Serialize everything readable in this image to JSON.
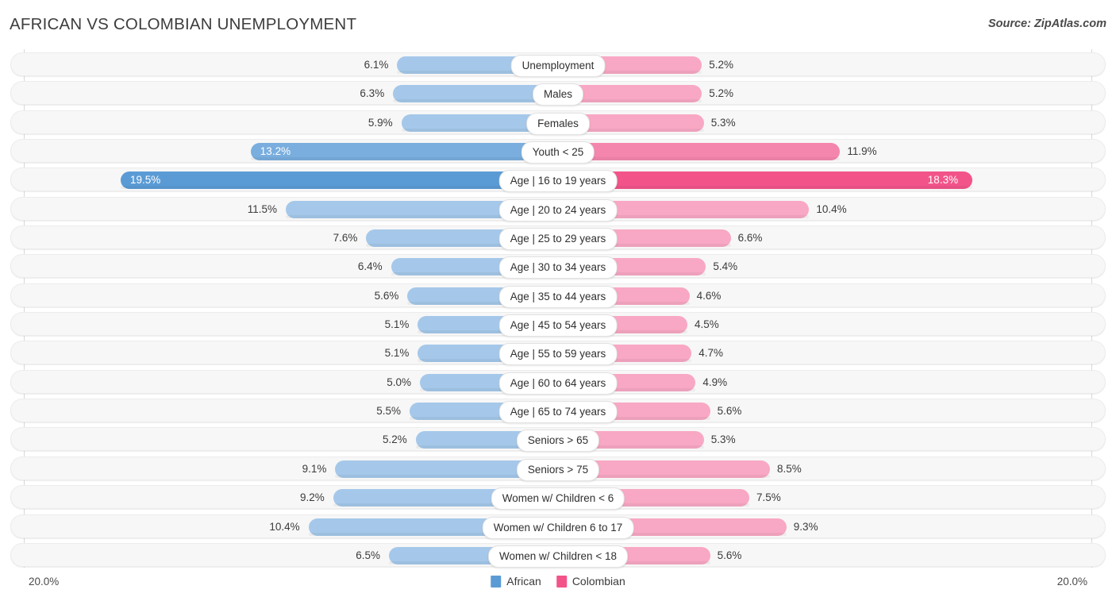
{
  "header": {
    "title": "AFRICAN VS COLOMBIAN UNEMPLOYMENT",
    "source": "Source: ZipAtlas.com"
  },
  "legend": {
    "items": [
      {
        "label": "African",
        "color": "#5b9bd5"
      },
      {
        "label": "Colombian",
        "color": "#f2548a"
      }
    ]
  },
  "axis": {
    "min_label": "20.0%",
    "max_label": "20.0%"
  },
  "chart_data": {
    "type": "bar",
    "title": "AFRICAN VS COLOMBIAN UNEMPLOYMENT",
    "subtitle": "Source: ZipAtlas.com",
    "orientation": "horizontal-diverging",
    "xlabel": "",
    "ylabel": "",
    "xlim": [
      20.0,
      20.0
    ],
    "grid": true,
    "legend_position": "bottom-center",
    "categories": [
      "Unemployment",
      "Males",
      "Females",
      "Youth < 25",
      "Age | 16 to 19 years",
      "Age | 20 to 24 years",
      "Age | 25 to 29 years",
      "Age | 30 to 34 years",
      "Age | 35 to 44 years",
      "Age | 45 to 54 years",
      "Age | 55 to 59 years",
      "Age | 60 to 64 years",
      "Age | 65 to 74 years",
      "Seniors > 65",
      "Seniors > 75",
      "Women w/ Children < 6",
      "Women w/ Children 6 to 17",
      "Women w/ Children < 18"
    ],
    "series": [
      {
        "name": "African",
        "color": "#a5c8ea",
        "values": [
          6.1,
          6.3,
          5.9,
          13.2,
          19.5,
          11.5,
          7.6,
          6.4,
          5.6,
          5.1,
          5.1,
          5.0,
          5.5,
          5.2,
          9.1,
          9.2,
          10.4,
          6.5
        ],
        "labels": [
          "6.1%",
          "6.3%",
          "5.9%",
          "13.2%",
          "19.5%",
          "11.5%",
          "7.6%",
          "6.4%",
          "5.6%",
          "5.1%",
          "5.1%",
          "5.0%",
          "5.5%",
          "5.2%",
          "9.1%",
          "9.2%",
          "10.4%",
          "6.5%"
        ]
      },
      {
        "name": "Colombian",
        "color": "#f8a8c4",
        "values": [
          5.2,
          5.2,
          5.3,
          11.9,
          18.3,
          10.4,
          6.6,
          5.4,
          4.6,
          4.5,
          4.7,
          4.9,
          5.6,
          5.3,
          8.5,
          7.5,
          9.3,
          5.6
        ],
        "labels": [
          "5.2%",
          "5.2%",
          "5.3%",
          "11.9%",
          "18.3%",
          "10.4%",
          "6.6%",
          "5.4%",
          "4.6%",
          "4.5%",
          "4.7%",
          "4.9%",
          "5.6%",
          "5.3%",
          "8.5%",
          "7.5%",
          "9.3%",
          "5.6%"
        ]
      }
    ],
    "rows": [
      {
        "category": "Unemployment",
        "left_value": 6.1,
        "left_label": "6.1%",
        "right_value": 5.2,
        "right_label": "5.2%",
        "emphasis": 0
      },
      {
        "category": "Males",
        "left_value": 6.3,
        "left_label": "6.3%",
        "right_value": 5.2,
        "right_label": "5.2%",
        "emphasis": 0
      },
      {
        "category": "Females",
        "left_value": 5.9,
        "left_label": "5.9%",
        "right_value": 5.3,
        "right_label": "5.3%",
        "emphasis": 0
      },
      {
        "category": "Youth < 25",
        "left_value": 13.2,
        "left_label": "13.2%",
        "right_value": 11.9,
        "right_label": "11.9%",
        "emphasis": 1
      },
      {
        "category": "Age | 16 to 19 years",
        "left_value": 19.5,
        "left_label": "19.5%",
        "right_value": 18.3,
        "right_label": "18.3%",
        "emphasis": 2
      },
      {
        "category": "Age | 20 to 24 years",
        "left_value": 11.5,
        "left_label": "11.5%",
        "right_value": 10.4,
        "right_label": "10.4%",
        "emphasis": 0
      },
      {
        "category": "Age | 25 to 29 years",
        "left_value": 7.6,
        "left_label": "7.6%",
        "right_value": 6.6,
        "right_label": "6.6%",
        "emphasis": 0
      },
      {
        "category": "Age | 30 to 34 years",
        "left_value": 6.4,
        "left_label": "6.4%",
        "right_value": 5.4,
        "right_label": "5.4%",
        "emphasis": 0
      },
      {
        "category": "Age | 35 to 44 years",
        "left_value": 5.6,
        "left_label": "5.6%",
        "right_value": 4.6,
        "right_label": "4.6%",
        "emphasis": 0
      },
      {
        "category": "Age | 45 to 54 years",
        "left_value": 5.1,
        "left_label": "5.1%",
        "right_value": 4.5,
        "right_label": "4.5%",
        "emphasis": 0
      },
      {
        "category": "Age | 55 to 59 years",
        "left_value": 5.1,
        "left_label": "5.1%",
        "right_value": 4.7,
        "right_label": "4.7%",
        "emphasis": 0
      },
      {
        "category": "Age | 60 to 64 years",
        "left_value": 5.0,
        "left_label": "5.0%",
        "right_value": 4.9,
        "right_label": "4.9%",
        "emphasis": 0
      },
      {
        "category": "Age | 65 to 74 years",
        "left_value": 5.5,
        "left_label": "5.5%",
        "right_value": 5.6,
        "right_label": "5.6%",
        "emphasis": 0
      },
      {
        "category": "Seniors > 65",
        "left_value": 5.2,
        "left_label": "5.2%",
        "right_value": 5.3,
        "right_label": "5.3%",
        "emphasis": 0
      },
      {
        "category": "Seniors > 75",
        "left_value": 9.1,
        "left_label": "9.1%",
        "right_value": 8.5,
        "right_label": "8.5%",
        "emphasis": 0
      },
      {
        "category": "Women w/ Children < 6",
        "left_value": 9.2,
        "left_label": "9.2%",
        "right_value": 7.5,
        "right_label": "7.5%",
        "emphasis": 0
      },
      {
        "category": "Women w/ Children 6 to 17",
        "left_value": 10.4,
        "left_label": "10.4%",
        "right_value": 9.3,
        "right_label": "9.3%",
        "emphasis": 0
      },
      {
        "category": "Women w/ Children < 18",
        "left_value": 6.5,
        "left_label": "6.5%",
        "right_value": 5.6,
        "right_label": "5.6%",
        "emphasis": 0
      }
    ]
  }
}
